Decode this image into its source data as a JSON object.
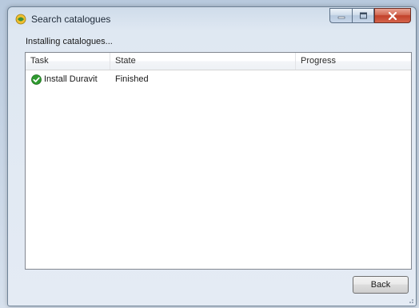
{
  "window": {
    "title": "Search catalogues",
    "status_text": "Installing catalogues..."
  },
  "listview": {
    "columns": [
      "Task",
      "State",
      "Progress"
    ],
    "rows": [
      {
        "task": "Install Duravit",
        "state": "Finished",
        "progress": "",
        "status_icon": "success-check-icon"
      }
    ]
  },
  "buttons": {
    "back_label": "Back"
  },
  "colors": {
    "success_green": "#2f9a2f",
    "close_red": "#c2412a"
  }
}
